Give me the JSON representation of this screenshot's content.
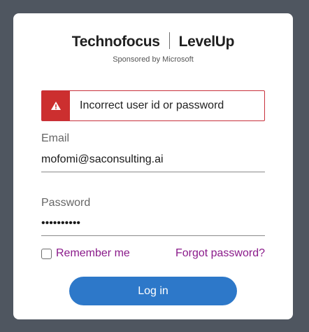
{
  "brand": {
    "name1": "Technofocus",
    "name2": "LevelUp",
    "sponsor": "Sponsored by Microsoft"
  },
  "alert": {
    "message": "Incorrect user id or password",
    "icon": "warning-icon",
    "color": "#cc2f2f"
  },
  "email": {
    "label": "Email",
    "value": "mofomi@saconsulting.ai"
  },
  "password": {
    "label": "Password",
    "value": "••••••••••"
  },
  "remember": {
    "label": "Remember me",
    "checked": false
  },
  "forgot": {
    "label": "Forgot password?"
  },
  "login": {
    "label": "Log in",
    "color": "#2d78c9"
  },
  "colors": {
    "background": "#4f5660",
    "link": "#8a1a8a"
  }
}
